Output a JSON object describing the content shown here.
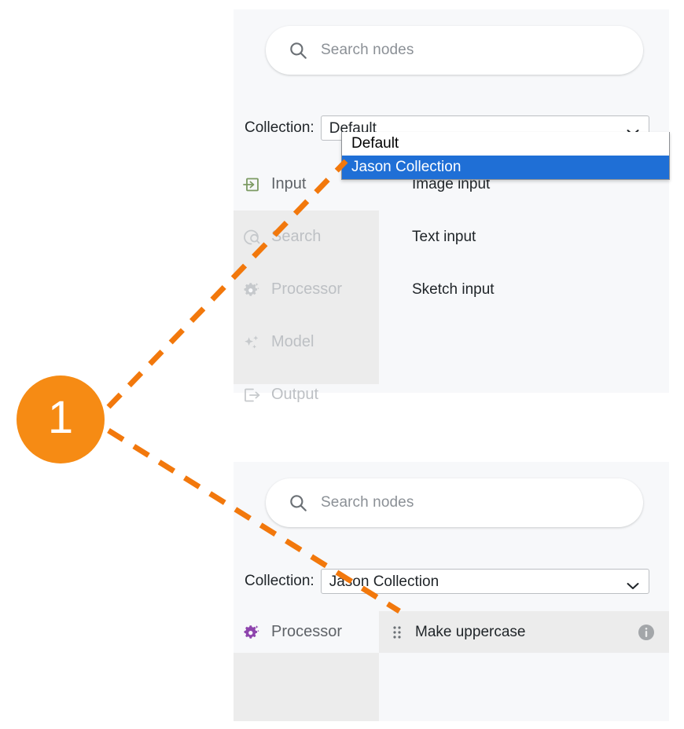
{
  "annotation": {
    "badge_number": "1",
    "badge_color": "#f68b14",
    "connector_color": "#f2780c"
  },
  "theme": {
    "panel_bg": "#f7f8fa",
    "category_bg": "#ececec",
    "select_border": "#bcbfc3",
    "highlight_blue": "#1f6fd6",
    "input_icon_color": "#7c9a63",
    "processor_icon_color": "#8e44ad",
    "disabled_text": "#bdc0c4",
    "text": "#1f2428"
  },
  "panel_one": {
    "search": {
      "icon": "search-icon",
      "placeholder": "Search nodes",
      "value": ""
    },
    "collection": {
      "label": "Collection:",
      "selected": "Default",
      "chevron_icon": "chevron-down-icon",
      "expanded": true,
      "options": [
        {
          "label": "Default",
          "selected": false
        },
        {
          "label": "Jason Collection",
          "selected": true
        }
      ]
    },
    "categories": [
      {
        "label": "Input",
        "icon": "arrow-into-box-icon",
        "state": "active"
      },
      {
        "label": "Search",
        "icon": "search-globe-icon",
        "state": "disabled"
      },
      {
        "label": "Processor",
        "icon": "gear-sparkle-icon",
        "state": "disabled"
      },
      {
        "label": "Model",
        "icon": "sparkle-icon",
        "state": "disabled"
      },
      {
        "label": "Output",
        "icon": "arrow-out-box-icon",
        "state": "disabled"
      }
    ],
    "nodes": [
      {
        "label": "Image input"
      },
      {
        "label": "Text input"
      },
      {
        "label": "Sketch input"
      }
    ]
  },
  "panel_two": {
    "search": {
      "icon": "search-icon",
      "placeholder": "Search nodes",
      "value": ""
    },
    "collection": {
      "label": "Collection:",
      "selected": "Jason Collection",
      "chevron_icon": "chevron-down-icon",
      "expanded": false,
      "options": [
        {
          "label": "Default",
          "selected": false
        },
        {
          "label": "Jason Collection",
          "selected": true
        }
      ]
    },
    "categories": [
      {
        "label": "Processor",
        "icon": "gear-sparkle-icon",
        "state": "active"
      }
    ],
    "nodes": [
      {
        "label": "Make uppercase",
        "drag_icon": "drag-handle-icon",
        "info_icon": "info-icon"
      }
    ]
  }
}
